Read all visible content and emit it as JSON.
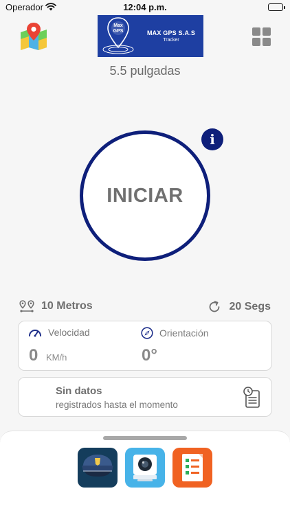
{
  "status_bar": {
    "carrier": "Operador",
    "time": "12:04 p.m."
  },
  "logo": {
    "mark_top": "Max",
    "mark_bottom": "GPS",
    "name": "MAX GPS S.A.S",
    "subtitle": "Tracker"
  },
  "device": {
    "size_label": "5.5 pulgadas"
  },
  "start": {
    "label": "INICIAR",
    "info_glyph": "i"
  },
  "settings": {
    "distance_label": "10 Metros",
    "interval_label": "20 Segs"
  },
  "stats": {
    "speed_label": "Velocidad",
    "speed_value": "0",
    "speed_unit": "KM/h",
    "heading_label": "Orientación",
    "heading_value": "0°"
  },
  "history": {
    "title": "Sin datos",
    "subtitle": "registrados hasta el momento"
  },
  "bottom_apps": [
    {
      "icon": "police-cap-icon"
    },
    {
      "icon": "camera-icon"
    },
    {
      "icon": "report-icon"
    }
  ],
  "colors": {
    "primary": "#0e1f7a",
    "logo_bg": "#1e3fa2",
    "text": "#6e6e6e",
    "police_bg": "#143d5c",
    "camera_bg": "#47b3e8",
    "report_bg": "#f06222"
  }
}
